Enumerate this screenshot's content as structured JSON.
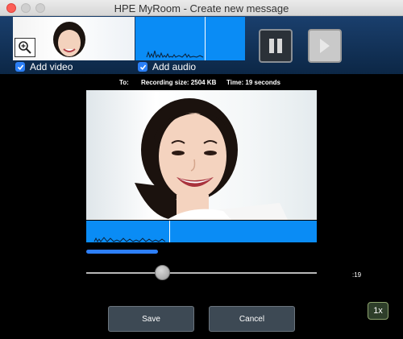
{
  "window": {
    "title": "HPE MyRoom - Create new message"
  },
  "media": {
    "add_video_label": "Add video",
    "add_video_checked": true,
    "add_audio_label": "Add audio",
    "add_audio_checked": true
  },
  "controls": {
    "pause_icon": "pause-icon",
    "play_icon": "play-icon",
    "zoom_icon": "zoom-in-icon"
  },
  "info": {
    "to_label": "To:",
    "recording_size": "Recording size: 2504 KB",
    "time": "Time: 19 seconds"
  },
  "playback": {
    "time_label": ":19",
    "progress_fraction": 0.31,
    "slider_fraction": 0.33
  },
  "buttons": {
    "save_label": "Save",
    "cancel_label": "Cancel",
    "speed_label": "1x"
  },
  "colors": {
    "accent_blue": "#0a8cf5",
    "checkbox_blue": "#2b7ff6",
    "header_bg": "#1a3f6d",
    "button_bg": "#3d4954"
  }
}
